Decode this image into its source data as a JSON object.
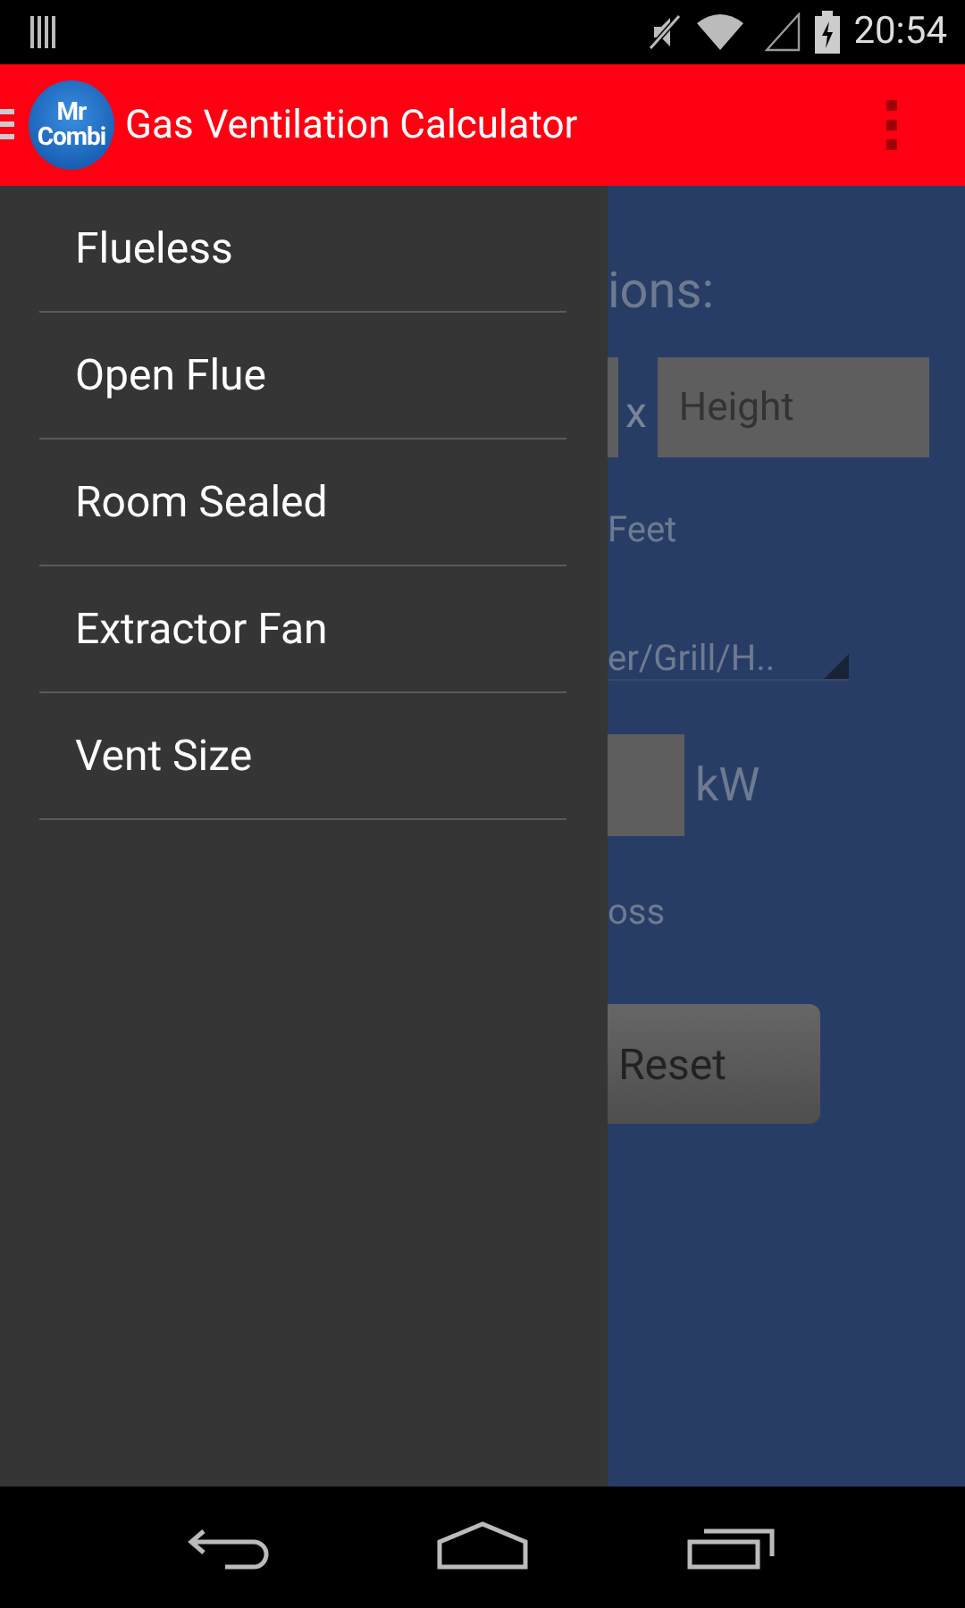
{
  "status_bar": {
    "time": "20:54"
  },
  "app_bar": {
    "logo_lines": [
      "Mr",
      "Combi"
    ],
    "title": "Gas Ventilation Calculator"
  },
  "drawer": {
    "items": [
      {
        "label": "Flueless"
      },
      {
        "label": "Open Flue"
      },
      {
        "label": "Room Sealed"
      },
      {
        "label": "Extractor Fan"
      },
      {
        "label": "Vent Size"
      }
    ]
  },
  "background_form": {
    "heading": "ions:",
    "times": "x",
    "height_placeholder": "Height",
    "unit_label": "Feet",
    "dropdown_value": "er/Grill/H..",
    "power_unit": "kW",
    "option_label": "oss",
    "reset_button": "Reset"
  }
}
